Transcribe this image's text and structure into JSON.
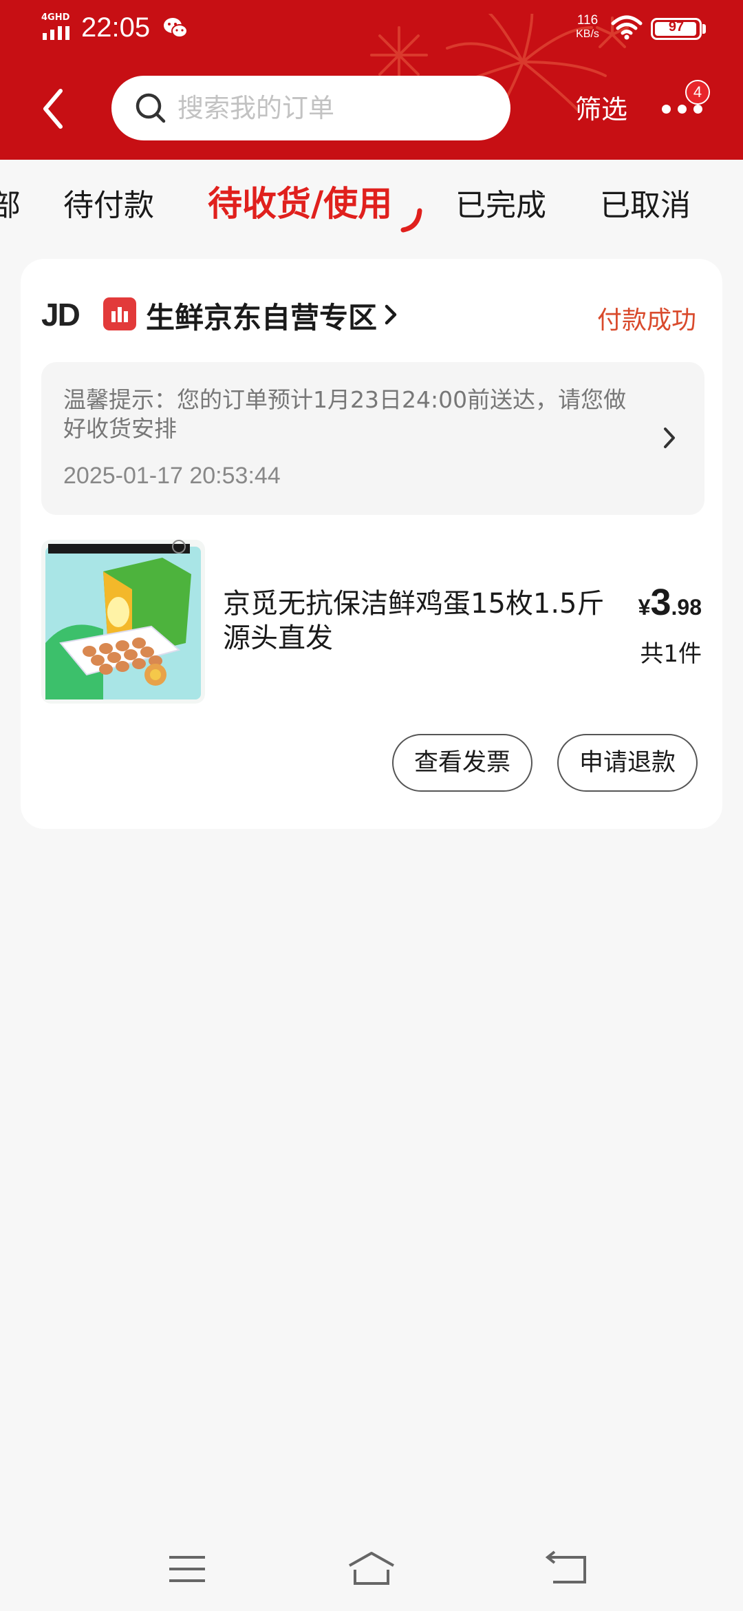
{
  "status_bar": {
    "network": "4GHD",
    "time": "22:05",
    "speed_value": "116",
    "speed_unit": "KB/s",
    "battery": "97",
    "battery_level": 0.97
  },
  "header": {
    "search_placeholder": "搜索我的订单",
    "filter_label": "筛选",
    "more_badge": "4"
  },
  "tabs": [
    {
      "label": "部"
    },
    {
      "label": "待付款"
    },
    {
      "label": "待收货/使用",
      "active": true
    },
    {
      "label": "已完成"
    },
    {
      "label": "已取消"
    }
  ],
  "order": {
    "brand_logo": "JD",
    "store_name": "生鲜京东自营专区",
    "status": "付款成功",
    "notice": {
      "text": "温馨提示：您的订单预计1月23日24:00前送达，请您做好收货安排",
      "time": "2025-01-17 20:53:44"
    },
    "product": {
      "title": "京觅无抗保洁鲜鸡蛋15枚1.5斤源头直发",
      "price_currency": "¥",
      "price_int": "3",
      "price_dec": ".98",
      "quantity": "共1件"
    },
    "actions": {
      "invoice": "查看发票",
      "refund": "申请退款"
    }
  },
  "colors": {
    "header_red": "#c70f14",
    "accent_red": "#e0201d",
    "status_orange": "#d94a2c"
  }
}
